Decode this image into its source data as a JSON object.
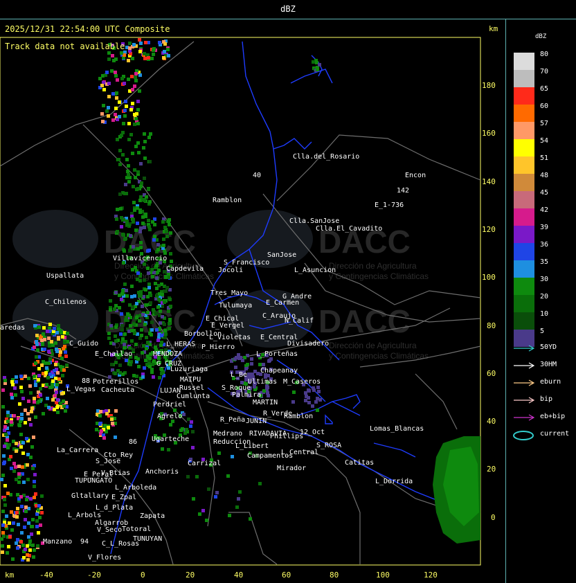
{
  "window_title": "dBZ",
  "header": {
    "timestamp": "2025/12/31 22:54:00 UTC Composite",
    "track_status": "Track data not available"
  },
  "axes": {
    "unit_label_top": "km",
    "unit_label_bottom": "km",
    "x_ticks": [
      "-40",
      "-20",
      "0",
      "20",
      "40",
      "60",
      "80",
      "100",
      "120"
    ],
    "y_ticks": [
      "180",
      "160",
      "140",
      "120",
      "100",
      "80",
      "60",
      "40",
      "20",
      "0"
    ]
  },
  "legend": {
    "title": "dBZ",
    "scale": [
      {
        "label": "80",
        "color": "#dcdcdc"
      },
      {
        "label": "70",
        "color": "#bdbdbd"
      },
      {
        "label": "65",
        "color": "#ff2a1a"
      },
      {
        "label": "60",
        "color": "#ff6a00"
      },
      {
        "label": "57",
        "color": "#ff9966"
      },
      {
        "label": "54",
        "color": "#ffff00"
      },
      {
        "label": "51",
        "color": "#ffc52a"
      },
      {
        "label": "48",
        "color": "#d08a3a"
      },
      {
        "label": "45",
        "color": "#c86a7a"
      },
      {
        "label": "42",
        "color": "#d61b8c"
      },
      {
        "label": "39",
        "color": "#7a19c8"
      },
      {
        "label": "36",
        "color": "#1f45e6"
      },
      {
        "label": "35",
        "color": "#1e8fe0"
      },
      {
        "label": "30",
        "color": "#0e8a0e"
      },
      {
        "label": "20",
        "color": "#0a6e0a"
      },
      {
        "label": "10",
        "color": "#0a4e0a"
      },
      {
        "label": "5",
        "color": "#4a3a8a"
      }
    ],
    "tracks": [
      {
        "label": "50YD",
        "color": "#33cccc"
      },
      {
        "label": "30HM",
        "color": "#ffffff"
      },
      {
        "label": "eburn",
        "color": "#ffcc88"
      },
      {
        "label": "bip",
        "color": "#ffcccc"
      },
      {
        "label": "eb+bip",
        "color": "#cc33cc"
      },
      {
        "label": "current",
        "color": "#33cccc"
      }
    ]
  },
  "watermark": {
    "brand": "DACC",
    "line1": "Dirección de Agricultura",
    "line2": "y Contingencias Climáticas"
  },
  "places": [
    "Clla.del_Rosario",
    "Encon",
    "142",
    "E_1-736",
    "Ramblon",
    "Clla.SanJose",
    "Clla.El_Cavadito",
    "Villavicencio",
    "S_Francisco",
    "SanJose",
    "Capdevila",
    "Jocoli",
    "L_Asuncion",
    "Uspallata",
    "Tres_Mayo",
    "G_Andre",
    "C_Chilenos",
    "Tulumaya",
    "E_Carmen",
    "C_Araujo",
    "E_Chical",
    "N_Calif",
    "E_Vergel",
    "Borbollon",
    "L_Violetas",
    "E_Central",
    "Divisadero",
    "C_Guido",
    "L_HERAS",
    "P_Hierro",
    "L_Porteñas",
    "E_Challao",
    "MENDOZA",
    "G_CRUZ",
    "Luzuriaga",
    "Chapeanay",
    "L_Be",
    "Ultimas",
    "Potrerillos",
    "MAIPU",
    "Russel",
    "Palmira",
    "M_Caseros",
    "L_Vegas",
    "Cacheuta",
    "LUJAN",
    "Cumlunta",
    "S_Roque",
    "MARTIN",
    "Perdriel",
    "R_Verde",
    "Ramblon",
    "Agrelo",
    "R_Peña",
    "JUNIN",
    "Medrano",
    "RIVADAVIA",
    "Phillips",
    "12_Oct",
    "Lomas_Blancas",
    "Ugarteche",
    "Reduccion",
    "L_Libert",
    "S_ROSA",
    "La_Carrera",
    "Cto_Rey",
    "S_Jose",
    "Campamentos",
    "L_Central",
    "Catitas",
    "Carrizal",
    "E_Peral",
    "V_Btias",
    "Anchoris",
    "Mirador",
    "TUPUNGATO",
    "L_Arboleda",
    "L_Dorrida",
    "Gltallary",
    "E_Zpal",
    "L_d_Plata",
    "L_Arbols",
    "Zapata",
    "Algarrob",
    "V_Seco",
    "Totoral",
    "Manzano",
    "TUNUYAN",
    "94",
    "C_L_Rosas",
    "V_Flores",
    "aredas",
    "88",
    "86",
    "40"
  ]
}
